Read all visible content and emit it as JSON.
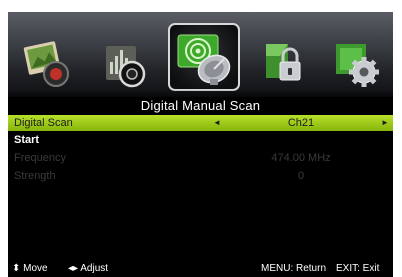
{
  "menu_icons": [
    {
      "name": "picture-icon"
    },
    {
      "name": "sound-icon"
    },
    {
      "name": "channel-icon"
    },
    {
      "name": "lock-icon"
    },
    {
      "name": "setup-icon"
    }
  ],
  "title": "Digital Manual Scan",
  "rows": {
    "digital_scan": {
      "label": "Digital Scan",
      "value": "Ch21",
      "left_arrow": "◄",
      "right_arrow": "►"
    },
    "start": {
      "label": "Start"
    },
    "frequency": {
      "label": "Frequency",
      "value": "474.00 MHz"
    },
    "strength": {
      "label": "Strength",
      "value": "0"
    }
  },
  "footer": {
    "move": "⬍ Move",
    "adjust": "◂▸ Adjust",
    "return": "MENU: Return",
    "exit": "EXIT: Exit"
  },
  "colors": {
    "highlight": "#a4cf1a",
    "disabled_text": "#3a3a3a",
    "background": "#000000"
  }
}
